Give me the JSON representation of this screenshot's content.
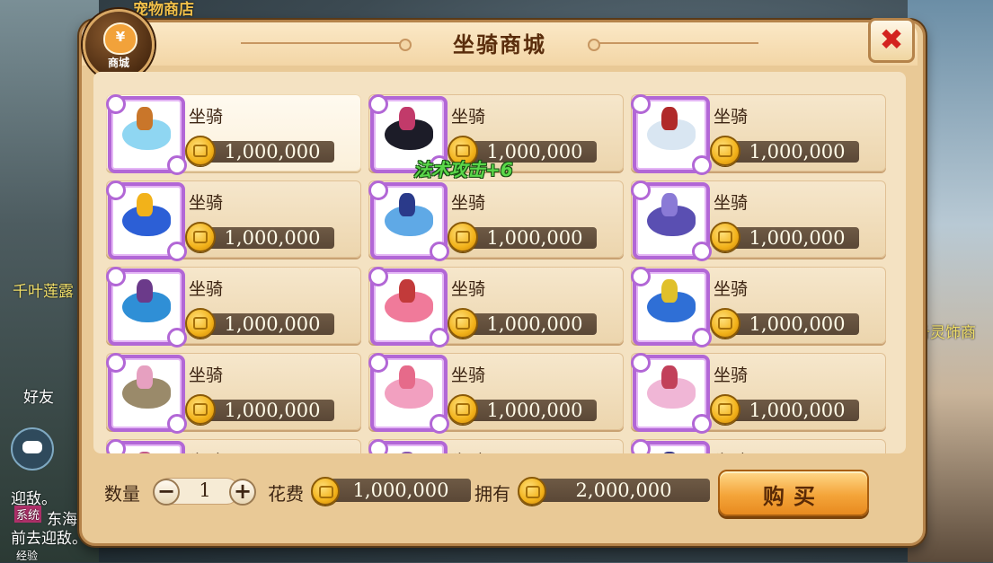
{
  "background": {
    "left_texts": [
      "千叶莲露",
      "好友",
      "迎敌。",
      "系统",
      "东海",
      "前去迎敌。",
      "经验"
    ],
    "right_text": "备灵饰商",
    "top_text": "宠物商店"
  },
  "dialog": {
    "title": "坐骑商城",
    "badge_label": "商城",
    "badge_symbol": "¥",
    "close_symbol": "✖"
  },
  "floating_text": "法术攻击+6",
  "items": [
    {
      "name": "坐骑",
      "price": "1,000,000",
      "mount_color": "#8fd6f2",
      "rider_color": "#c9762a",
      "selected": true
    },
    {
      "name": "坐骑",
      "price": "1,000,000",
      "mount_color": "#1c1c28",
      "rider_color": "#c23a6a",
      "selected": false
    },
    {
      "name": "坐骑",
      "price": "1,000,000",
      "mount_color": "#d9e6f2",
      "rider_color": "#b02a2a",
      "selected": false
    },
    {
      "name": "坐骑",
      "price": "1,000,000",
      "mount_color": "#2c5fd6",
      "rider_color": "#f2b21a",
      "selected": false
    },
    {
      "name": "坐骑",
      "price": "1,000,000",
      "mount_color": "#5fa9e6",
      "rider_color": "#2a3a8a",
      "selected": false
    },
    {
      "name": "坐骑",
      "price": "1,000,000",
      "mount_color": "#5a4fb2",
      "rider_color": "#8a7ad6",
      "selected": false
    },
    {
      "name": "坐骑",
      "price": "1,000,000",
      "mount_color": "#2f8fd6",
      "rider_color": "#6b3a8a",
      "selected": false
    },
    {
      "name": "坐骑",
      "price": "1,000,000",
      "mount_color": "#f07a9a",
      "rider_color": "#c23a3a",
      "selected": false
    },
    {
      "name": "坐骑",
      "price": "1,000,000",
      "mount_color": "#2f6fd6",
      "rider_color": "#e0c02a",
      "selected": false
    },
    {
      "name": "坐骑",
      "price": "1,000,000",
      "mount_color": "#9a8a6a",
      "rider_color": "#e6a0c0",
      "selected": false
    },
    {
      "name": "坐骑",
      "price": "1,000,000",
      "mount_color": "#f2a0c0",
      "rider_color": "#e66a8a",
      "selected": false
    },
    {
      "name": "坐骑",
      "price": "1,000,000",
      "mount_color": "#f0b6d6",
      "rider_color": "#c2405a",
      "selected": false
    },
    {
      "name": "坐骑",
      "price": "",
      "mount_color": "#e6c0d6",
      "rider_color": "#c25a8a",
      "selected": false
    },
    {
      "name": "坐骑",
      "price": "",
      "mount_color": "#c0a0e0",
      "rider_color": "#8a5ab2",
      "selected": false
    },
    {
      "name": "坐骑",
      "price": "",
      "mount_color": "#f2d06a",
      "rider_color": "#3a3a8a",
      "selected": false
    }
  ],
  "footer": {
    "qty_label": "数量",
    "qty_value": "1",
    "minus": "−",
    "plus": "+",
    "cost_label": "花费",
    "cost_value": "1,000,000",
    "own_label": "拥有",
    "own_value": "2,000,000",
    "buy_label": "购买"
  }
}
